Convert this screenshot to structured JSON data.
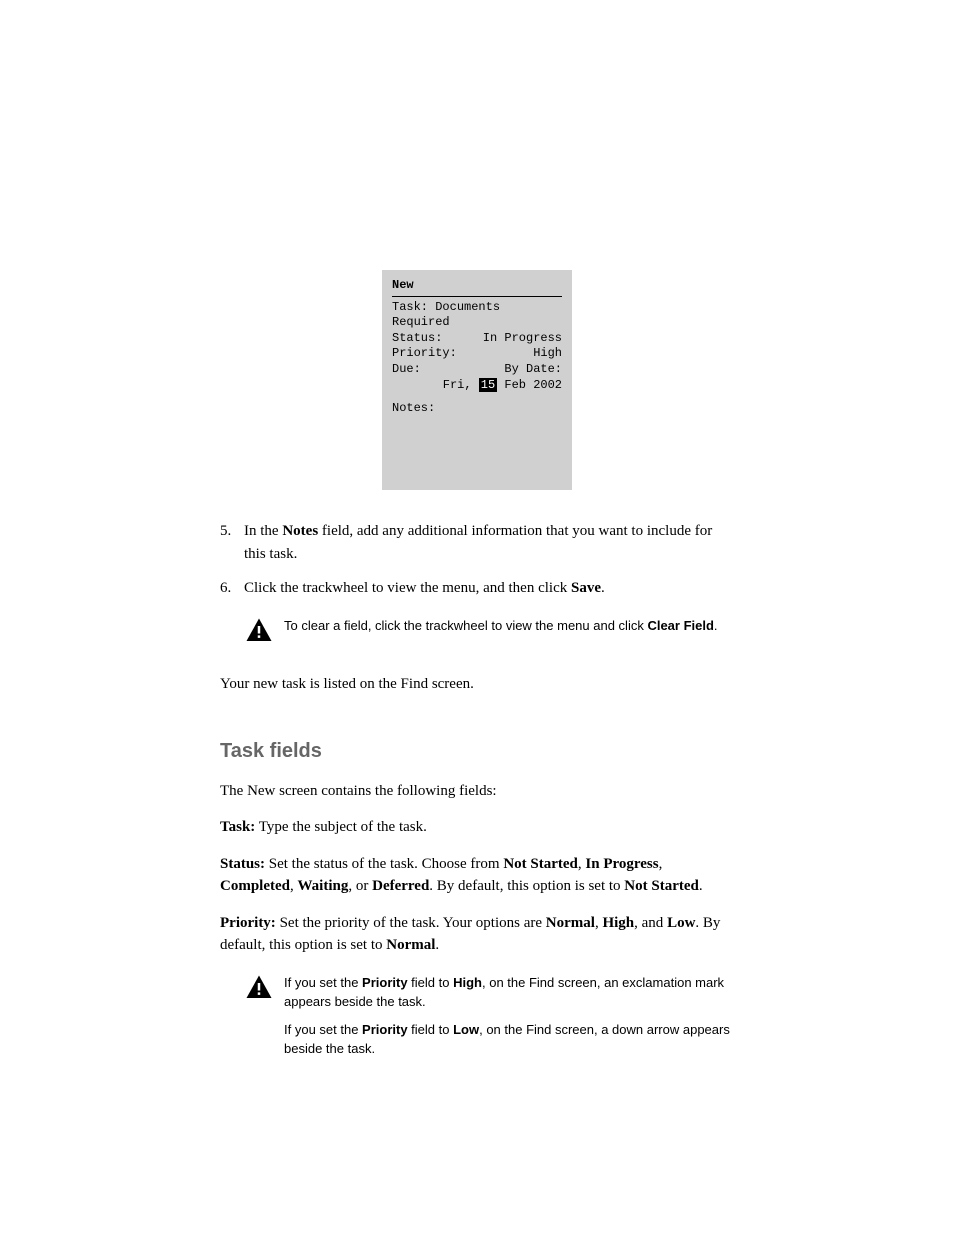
{
  "device": {
    "title": "New",
    "rows": [
      {
        "label": "Task:",
        "value": "Documents Required",
        "inline": true
      },
      {
        "label": "Status:",
        "value": "In Progress"
      },
      {
        "label": "Priority:",
        "value": "High"
      },
      {
        "label": "Due:",
        "value": "By Date:"
      }
    ],
    "date_prefix": "Fri, ",
    "date_day": "15",
    "date_suffix": " Feb 2002",
    "notes_label": "Notes:"
  },
  "steps": {
    "five": {
      "num": "5.",
      "text_pre": "In the ",
      "field": "Notes",
      "text_post": " field, add any additional information that you want to include for this task."
    },
    "six": {
      "num": "6.",
      "text_pre": "Click the trackwheel to view the menu, and then click ",
      "save": "Save",
      "text_post": "."
    }
  },
  "note1": {
    "text": "To clear a field, click the trackwheel to view the menu and click ",
    "action": "Clear Field",
    "text_post": "."
  },
  "para1": "Your new task is listed on the Find screen.",
  "heading": "Task fields",
  "para2": "The New screen contains the following fields:",
  "task_field": {
    "label": "Task:",
    "text": " Type the subject of the task."
  },
  "status_field": {
    "label": "Status:",
    "text1": " Set the status of the task. Choose from ",
    "opt1": "Not Started",
    "sep1": ", ",
    "opt2": "In Progress",
    "sep2": ", ",
    "opt3": "Completed",
    "sep3": ", ",
    "opt4": "Waiting",
    "sep4": ", or ",
    "opt5": "Deferred",
    "text2": ". By default, this option is set to ",
    "default": "Not Started",
    "text3": "."
  },
  "priority_field": {
    "label": "Priority:",
    "text1": " Set the priority of the task. Your options are ",
    "opt1": "Normal",
    "sep1": ", ",
    "opt2": "High",
    "sep2": ", and ",
    "opt3": "Low",
    "text2": ". By default, this option is set to ",
    "default": "Normal",
    "text3": "."
  },
  "note2": {
    "p1_pre": "If you set the ",
    "p1_field": "Priority",
    "p1_mid": " field to ",
    "p1_val": "High",
    "p1_post": ", on the Find screen, an exclamation mark appears beside the task.",
    "p2_pre": "If you set the ",
    "p2_field": "Priority",
    "p2_mid": " field to ",
    "p2_val": "Low",
    "p2_post": ", on the Find screen, a down arrow appears beside the task."
  }
}
